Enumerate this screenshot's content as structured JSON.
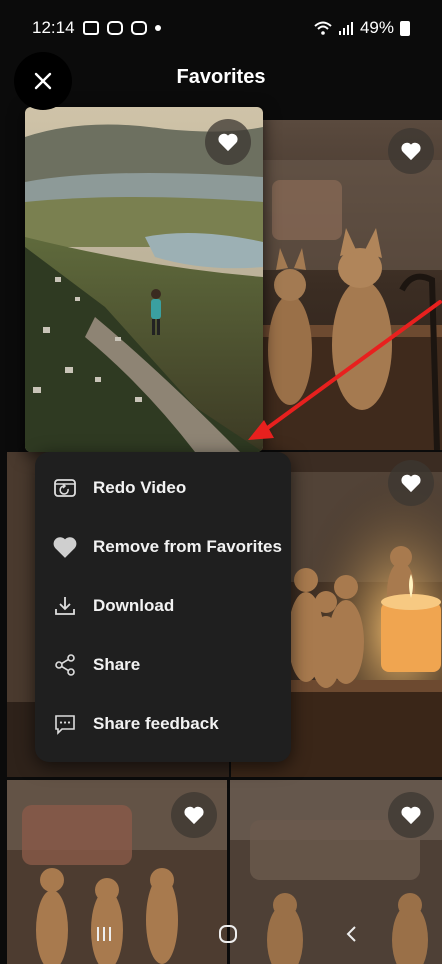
{
  "status_bar": {
    "time": "12:14",
    "battery": "49%",
    "notification_icons": [
      "gallery-notification-icon",
      "instagram-icon",
      "instagram-icon"
    ],
    "status_icons": [
      "wifi-icon",
      "signal-icon",
      "battery-icon"
    ]
  },
  "header": {
    "title": "Favorites",
    "close_icon": "close-icon"
  },
  "grid": {
    "tiles": [
      {
        "subject": "hiker on mountain trail above lake",
        "favorited": true
      },
      {
        "subject": "wooden cat figurines on table",
        "favorited": true
      },
      {
        "subject": "wooden cat figurines",
        "favorited": false
      },
      {
        "subject": "wooden cat figurines with candle",
        "favorited": true
      },
      {
        "subject": "wooden cat figurines in living room",
        "favorited": true
      },
      {
        "subject": "wooden cat figurines in living room",
        "favorited": true
      }
    ]
  },
  "context_menu": {
    "items": [
      {
        "label": "Redo Video",
        "icon": "redo-video-icon"
      },
      {
        "label": "Remove from Favorites",
        "icon": "heart-icon"
      },
      {
        "label": "Download",
        "icon": "download-icon"
      },
      {
        "label": "Share",
        "icon": "share-icon"
      },
      {
        "label": "Share feedback",
        "icon": "feedback-icon"
      }
    ]
  },
  "nav_bar": {
    "buttons": [
      "recent-apps-icon",
      "home-icon",
      "back-icon"
    ]
  },
  "colors": {
    "menu_background": "#1f1f1f",
    "annotation_arrow": "#e8201e",
    "heart": "#ffffff"
  }
}
